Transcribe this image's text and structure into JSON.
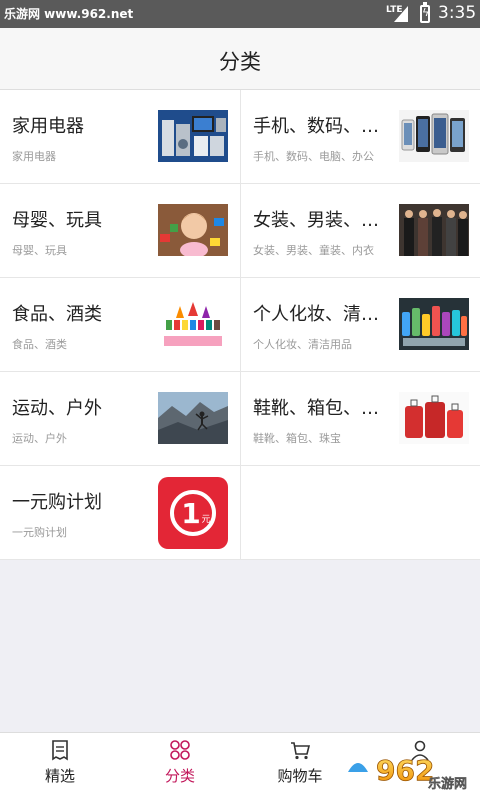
{
  "status_bar": {
    "watermark": "乐游网 www.962.net",
    "network": "LTE",
    "time": "3:35"
  },
  "header": {
    "title": "分类"
  },
  "categories": [
    {
      "title": "家用电器",
      "subtitle": "家用电器",
      "thumb_icon": "appliances-image"
    },
    {
      "title": "手机、数码、电...",
      "subtitle": "手机、数码、电脑、办公",
      "thumb_icon": "phones-image"
    },
    {
      "title": "母婴、玩具",
      "subtitle": "母婴、玩具",
      "thumb_icon": "baby-toys-image"
    },
    {
      "title": "女装、男装、童...",
      "subtitle": "女装、男装、童装、内衣",
      "thumb_icon": "fashion-image"
    },
    {
      "title": "食品、酒类",
      "subtitle": "食品、酒类",
      "thumb_icon": "food-drinks-image"
    },
    {
      "title": "个人化妆、清洁...",
      "subtitle": "个人化妆、清洁用品",
      "thumb_icon": "cleaning-products-image"
    },
    {
      "title": "运动、户外",
      "subtitle": "运动、户外",
      "thumb_icon": "outdoor-sports-image"
    },
    {
      "title": "鞋靴、箱包、珠...",
      "subtitle": "鞋靴、箱包、珠宝",
      "thumb_icon": "luggage-image"
    },
    {
      "title": "一元购计划",
      "subtitle": "一元购计划",
      "thumb_icon": "one-yuan-badge",
      "badge_number": "1",
      "badge_unit": "元"
    }
  ],
  "bottom_nav": [
    {
      "label": "精选",
      "icon": "receipt-icon",
      "active": false
    },
    {
      "label": "分类",
      "icon": "grid-icon",
      "active": true
    },
    {
      "label": "购物车",
      "icon": "cart-icon",
      "active": false
    },
    {
      "label": "",
      "icon": "user-icon",
      "active": false
    }
  ],
  "overlay_logo": {
    "text": "962",
    "subtext": "乐游网"
  },
  "colors": {
    "accent": "#c2185b",
    "statusbar": "#5a5a5a",
    "badge": "#e32636"
  }
}
